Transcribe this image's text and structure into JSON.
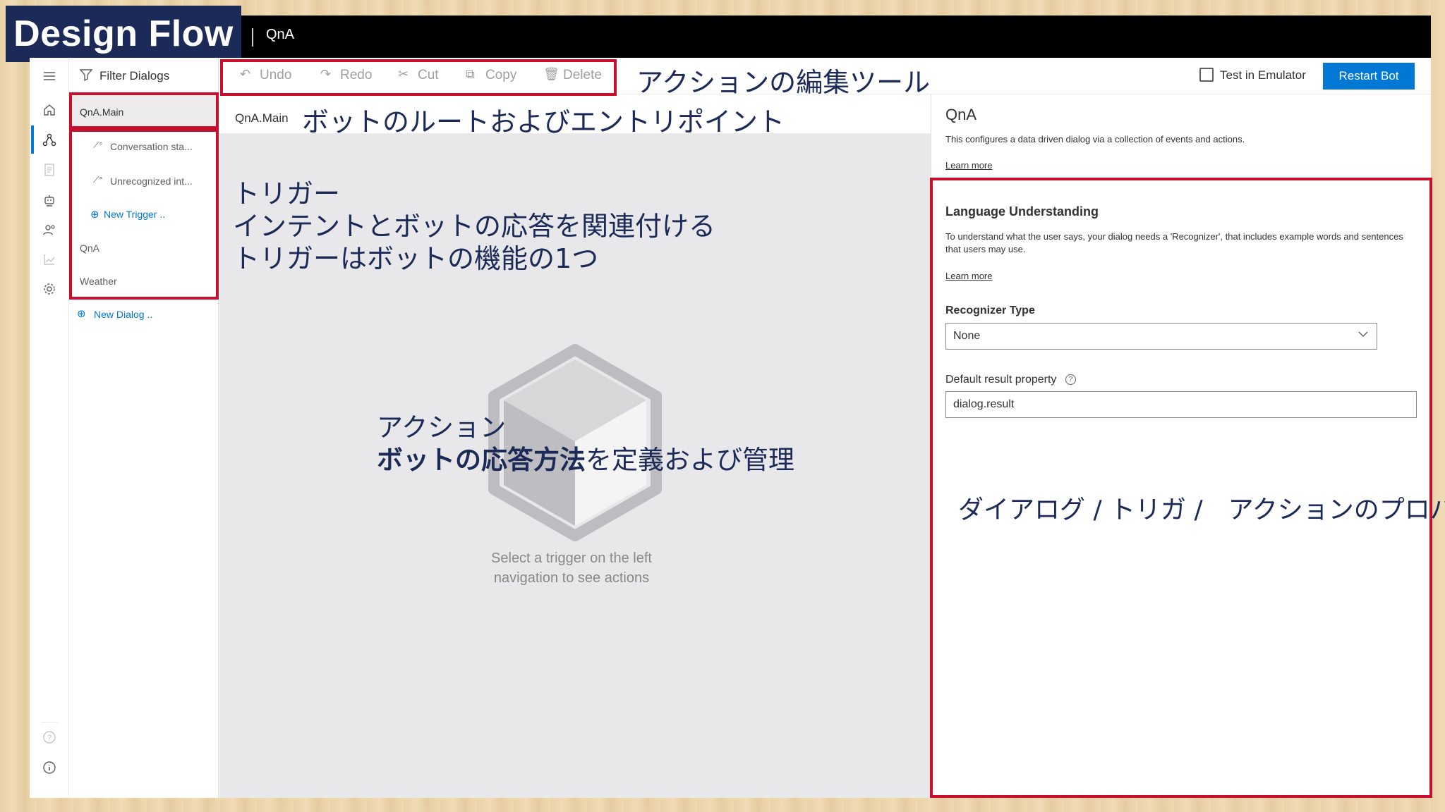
{
  "overlay_title": "Design Flow",
  "header": {
    "title": "QnA"
  },
  "rail": {
    "icons": [
      "menu-icon",
      "home-icon",
      "design-flow-icon",
      "document-icon",
      "bot-icon",
      "users-icon",
      "analytics-icon",
      "settings-icon",
      "help-icon",
      "info-icon"
    ]
  },
  "nav": {
    "filter_label": "Filter Dialogs",
    "root_dialog": "QnA.Main",
    "triggers": [
      "Conversation sta...",
      "Unrecognized int..."
    ],
    "new_trigger": "New Trigger ..",
    "dialogs": [
      "QnA",
      "Weather"
    ],
    "new_dialog": "New Dialog .."
  },
  "toolbar": {
    "undo": "Undo",
    "redo": "Redo",
    "cut": "Cut",
    "copy": "Copy",
    "delete": "Delete",
    "test_emulator": "Test in Emulator",
    "restart_bot": "Restart Bot"
  },
  "canvas": {
    "breadcrumb": "QnA.Main",
    "empty_line1": "Select a trigger on the left",
    "empty_line2": "navigation to see actions"
  },
  "properties": {
    "title": "QnA",
    "description": "This configures a data driven dialog via a collection of events and actions.",
    "learn_more": "Learn more",
    "lu_title": "Language Understanding",
    "lu_description": "To understand what the user says, your dialog needs a 'Recognizer', that includes example words and sentences that users may use.",
    "lu_learn_more": "Learn more",
    "recognizer_label": "Recognizer Type",
    "recognizer_value": "None",
    "default_result_label": "Default result property",
    "default_result_value": "dialog.result"
  },
  "annotations": {
    "toolbar_note": "アクションの編集ツール",
    "root_note": "ボットのルートおよびエントリポイント",
    "trigger_line1": "トリガー",
    "trigger_line2": "インテントとボットの応答を関連付ける",
    "trigger_line3": "トリガーはボットの機能の1つ",
    "action_line1": "アクション",
    "action_bold": "ボットの応答方法",
    "action_rest": "を定義および管理",
    "props_note": "ダイアログ / トリガ /　アクションのプロパティ"
  },
  "colors": {
    "accent": "#0078d4",
    "annotation_red": "#c8102e",
    "annotation_text": "#1b2a57"
  }
}
